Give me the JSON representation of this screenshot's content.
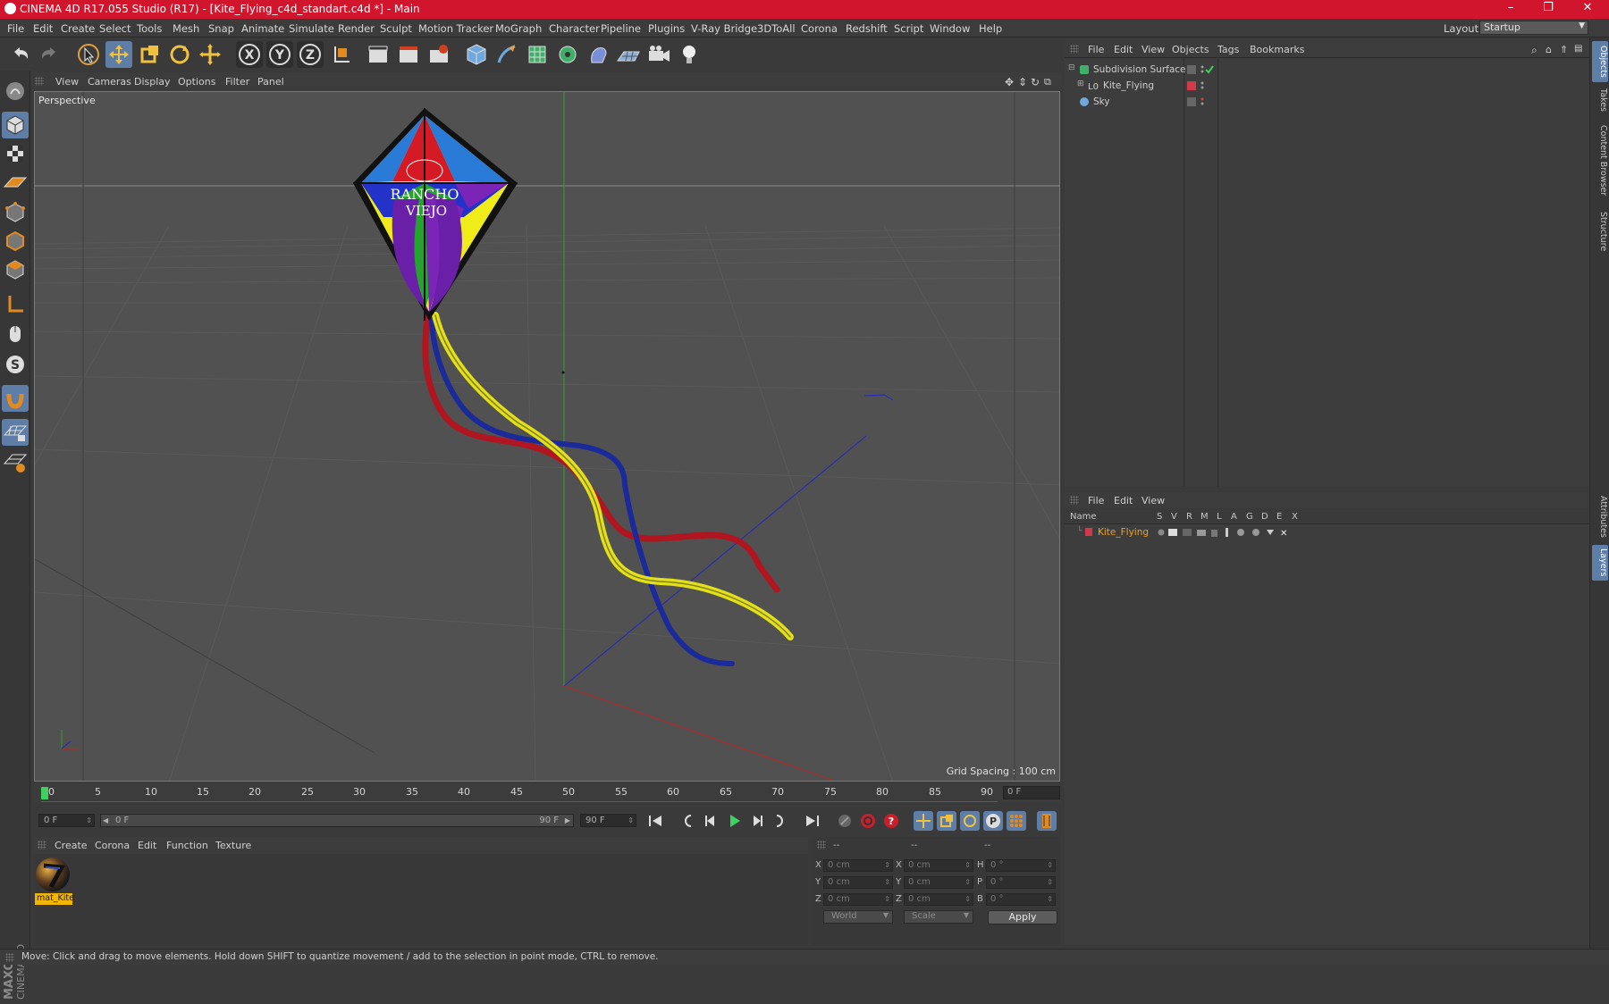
{
  "window": {
    "title": "CINEMA 4D R17.055 Studio (R17) - [Kite_Flying_c4d_standart.c4d *] - Main",
    "minimize": "–",
    "maximize": "❐",
    "close": "✕"
  },
  "menubar": {
    "items": [
      "File",
      "Edit",
      "Create",
      "Select",
      "Tools",
      "Mesh",
      "Snap",
      "Animate",
      "Simulate",
      "Render",
      "Sculpt",
      "Motion Tracker",
      "MoGraph",
      "Character",
      "Pipeline",
      "Plugins",
      "V-Ray Bridge",
      "3DToAll",
      "Corona",
      "Redshift",
      "Script",
      "Window",
      "Help"
    ],
    "layout_label": "Layout:",
    "layout_value": "Startup"
  },
  "viewport": {
    "menu": [
      "View",
      "Cameras",
      "Display",
      "Options",
      "Filter",
      "Panel"
    ],
    "label": "Perspective",
    "grid_spacing": "Grid Spacing : 100 cm",
    "kite_text_1": "RANCHO",
    "kite_text_2": "VIEJO"
  },
  "timeline": {
    "ticks": [
      "0",
      "5",
      "10",
      "15",
      "20",
      "25",
      "30",
      "35",
      "40",
      "45",
      "50",
      "55",
      "60",
      "65",
      "70",
      "75",
      "80",
      "85",
      "90"
    ],
    "current_frame_right": "0 F"
  },
  "transport": {
    "start_field": "0 F",
    "slider_left": "0 F",
    "slider_right": "90 F",
    "end_field": "90 F"
  },
  "material_manager": {
    "menu": [
      "Create",
      "Corona",
      "Edit",
      "Function",
      "Texture"
    ],
    "materials": [
      {
        "name": "mat_Kite"
      }
    ]
  },
  "coordinates": {
    "header": [
      "--",
      "--",
      "--"
    ],
    "rows": [
      {
        "axis1": "X",
        "val1": "0 cm",
        "axis2": "X",
        "val2": "0 cm",
        "axis3": "H",
        "val3": "0 °"
      },
      {
        "axis1": "Y",
        "val1": "0 cm",
        "axis2": "Y",
        "val2": "0 cm",
        "axis3": "P",
        "val3": "0 °"
      },
      {
        "axis1": "Z",
        "val1": "0 cm",
        "axis2": "Z",
        "val2": "0 cm",
        "axis3": "B",
        "val3": "0 °"
      }
    ],
    "mode1": "World",
    "mode2": "Scale",
    "apply": "Apply"
  },
  "object_manager": {
    "menu": [
      "File",
      "Edit",
      "View",
      "Objects",
      "Tags",
      "Bookmarks"
    ],
    "objects": [
      {
        "name": "Subdivision Surface"
      },
      {
        "name": "Kite_Flying"
      },
      {
        "name": "Sky"
      }
    ]
  },
  "layer_manager": {
    "menu": [
      "File",
      "Edit",
      "View"
    ],
    "columns": [
      "Name",
      "S",
      "V",
      "R",
      "M",
      "L",
      "A",
      "G",
      "D",
      "E",
      "X"
    ],
    "layers": [
      {
        "name": "Kite_Flying"
      }
    ]
  },
  "side_tabs": [
    "Objects",
    "Takes",
    "Content Browser",
    "Structure",
    "Attributes",
    "Layers"
  ],
  "status": "Move: Click and drag to move elements. Hold down SHIFT to quantize movement / add to the selection in point mode, CTRL to remove.",
  "colors": {
    "title_bar": "#d0152c",
    "accent": "#5e7ea8",
    "layer_color": "#d23a4a",
    "material_label": "#f2b600"
  }
}
